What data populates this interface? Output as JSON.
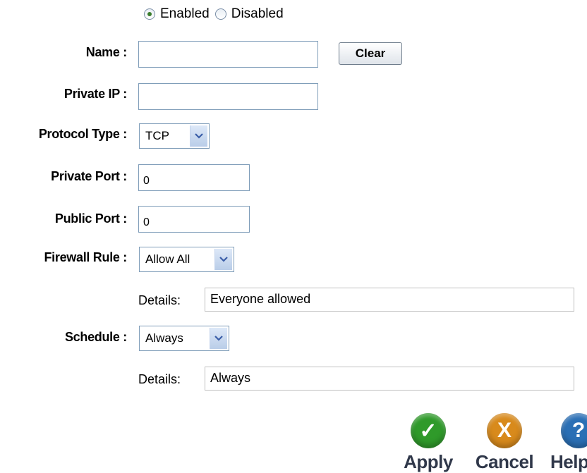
{
  "status": {
    "enabled_label": "Enabled",
    "disabled_label": "Disabled",
    "selected": "Enabled"
  },
  "fields": {
    "name": {
      "label": "Name :",
      "value": ""
    },
    "private_ip": {
      "label": "Private IP :",
      "value": ""
    },
    "protocol_type": {
      "label": "Protocol Type :",
      "value": "TCP"
    },
    "private_port": {
      "label": "Private Port :",
      "value": "0"
    },
    "public_port": {
      "label": "Public Port :",
      "value": "0"
    },
    "firewall_rule": {
      "label": "Firewall Rule :",
      "value": "Allow All",
      "details_label": "Details:",
      "details_value": "Everyone allowed"
    },
    "schedule": {
      "label": "Schedule :",
      "value": "Always",
      "details_label": "Details:",
      "details_value": "Always"
    }
  },
  "buttons": {
    "clear": "Clear",
    "apply": "Apply",
    "cancel": "Cancel",
    "help": "Help"
  },
  "icons": {
    "apply": "checkmark-icon",
    "cancel": "x-icon",
    "help": "question-icon",
    "apply_glyph": "✓",
    "cancel_glyph": "X",
    "help_glyph": "?"
  },
  "colors": {
    "apply": "#2f9a2a",
    "cancel": "#d88a1c",
    "help": "#2a6fb5"
  }
}
